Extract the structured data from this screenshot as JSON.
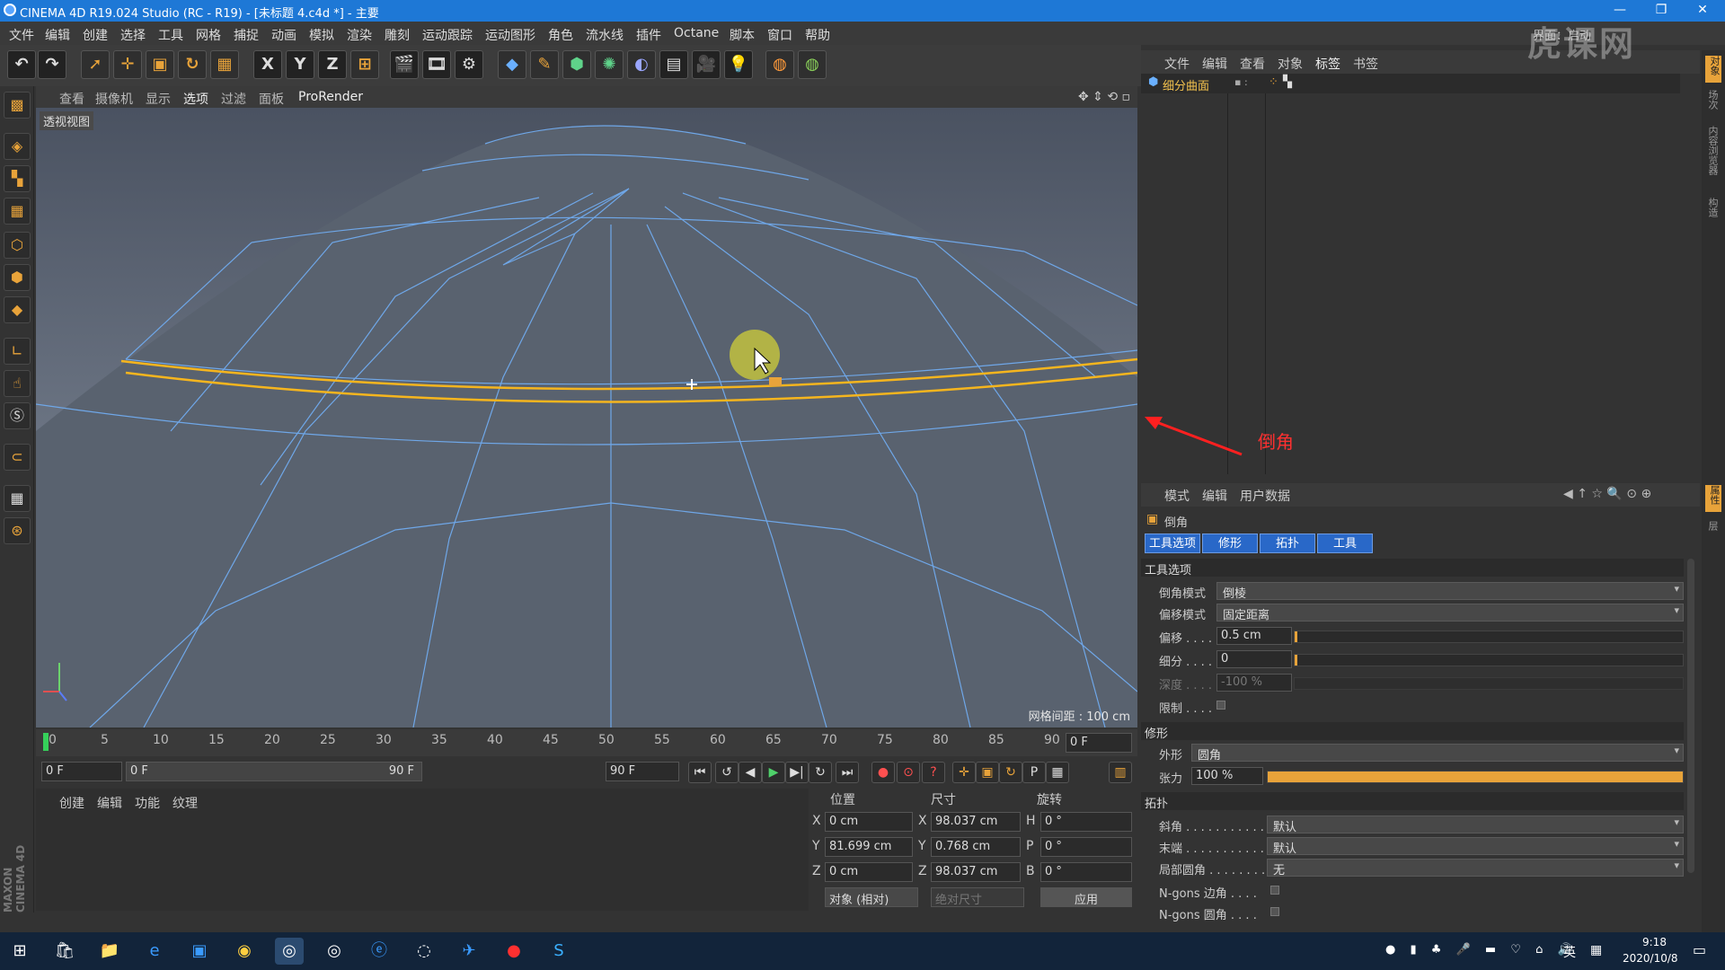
{
  "window": {
    "title": "CINEMA 4D R19.024 Studio (RC - R19) - [未标题 4.c4d *] - 主要"
  },
  "menu": [
    "文件",
    "编辑",
    "创建",
    "选择",
    "工具",
    "网格",
    "捕捉",
    "动画",
    "模拟",
    "渲染",
    "雕刻",
    "运动跟踪",
    "运动图形",
    "角色",
    "流水线",
    "插件",
    "Octane",
    "脚本",
    "窗口",
    "帮助"
  ],
  "layout_label": "界面：启动",
  "toolbar": {
    "x": "X",
    "y": "Y",
    "z": "Z"
  },
  "viewport": {
    "menu": [
      "查看",
      "摄像机",
      "显示",
      "选项",
      "过滤",
      "面板",
      "ProRender"
    ],
    "label": "透视视图",
    "grid_info": "网格间距 : 100 cm"
  },
  "timeline": {
    "ticks": [
      "0",
      "5",
      "10",
      "15",
      "20",
      "25",
      "30",
      "35",
      "40",
      "45",
      "50",
      "55",
      "60",
      "65",
      "70",
      "75",
      "80",
      "85",
      "90"
    ],
    "current_frame": "0 F",
    "start": "0 F",
    "range_start": "0 F",
    "range_end": "90 F",
    "end": "90 F"
  },
  "material_panel": {
    "tabs": [
      "创建",
      "编辑",
      "功能",
      "纹理"
    ]
  },
  "coords": {
    "headers": {
      "position": "位置",
      "size": "尺寸",
      "rotation": "旋转"
    },
    "rows": [
      {
        "axis": "X",
        "pos": "0 cm",
        "size_axis": "X",
        "size": "98.037 cm",
        "rot_axis": "H",
        "rot": "0 °"
      },
      {
        "axis": "Y",
        "pos": "81.699 cm",
        "size_axis": "Y",
        "size": "0.768 cm",
        "rot_axis": "P",
        "rot": "0 °"
      },
      {
        "axis": "Z",
        "pos": "0 cm",
        "size_axis": "Z",
        "size": "98.037 cm",
        "rot_axis": "B",
        "rot": "0 °"
      }
    ],
    "mode": "对象 (相对)",
    "size_mode": "绝对尺寸",
    "apply": "应用"
  },
  "object_manager": {
    "menu": [
      "文件",
      "编辑",
      "查看",
      "对象",
      "标签",
      "书签"
    ],
    "objects": [
      {
        "name": "细分曲面"
      }
    ]
  },
  "attr_manager": {
    "menu": [
      "模式",
      "编辑",
      "用户数据"
    ],
    "tool_name": "倒角",
    "tabs": [
      "工具选项",
      "修形",
      "拓扑",
      "工具"
    ],
    "sections": {
      "tool_options": "工具选项",
      "shaping": "修形",
      "topology": "拓扑"
    },
    "fields": {
      "bevel_mode_label": "倒角模式",
      "bevel_mode": "倒棱",
      "offset_mode_label": "偏移模式",
      "offset_mode": "固定距离",
      "offset_label": "偏移 . . . .",
      "offset": "0.5 cm",
      "subdiv_label": "细分 . . . .",
      "subdiv": "0",
      "depth_label": "深度 . . . .",
      "depth": "-100 %",
      "limit_label": "限制 . . . .",
      "shape_label": "外形",
      "shape": "圆角",
      "tension_label": "张力",
      "tension": "100 %",
      "tension_level": 1.0,
      "miter_label": "斜角 . . . . . . . . . . . . .",
      "miter": "默认",
      "end_label": "末端 . . . . . . . . . . . . .",
      "end": "默认",
      "partial_label": "局部圆角 . . . . . . . . .",
      "partial": "无",
      "ngon_edge_label": "N-gons 边角 . . . .",
      "ngon_round_label": "N-gons 圆角 . . . ."
    }
  },
  "right_strip": [
    "对象",
    "场次",
    "内容浏览器",
    "构造"
  ],
  "right_strip_attr": [
    "属性",
    "层"
  ],
  "annotation": "倒角",
  "watermark": "虎课网",
  "taskbar": {
    "time": "9:18",
    "date": "2020/10/8",
    "ime": "英"
  },
  "branding": "MAXON CINEMA 4D"
}
